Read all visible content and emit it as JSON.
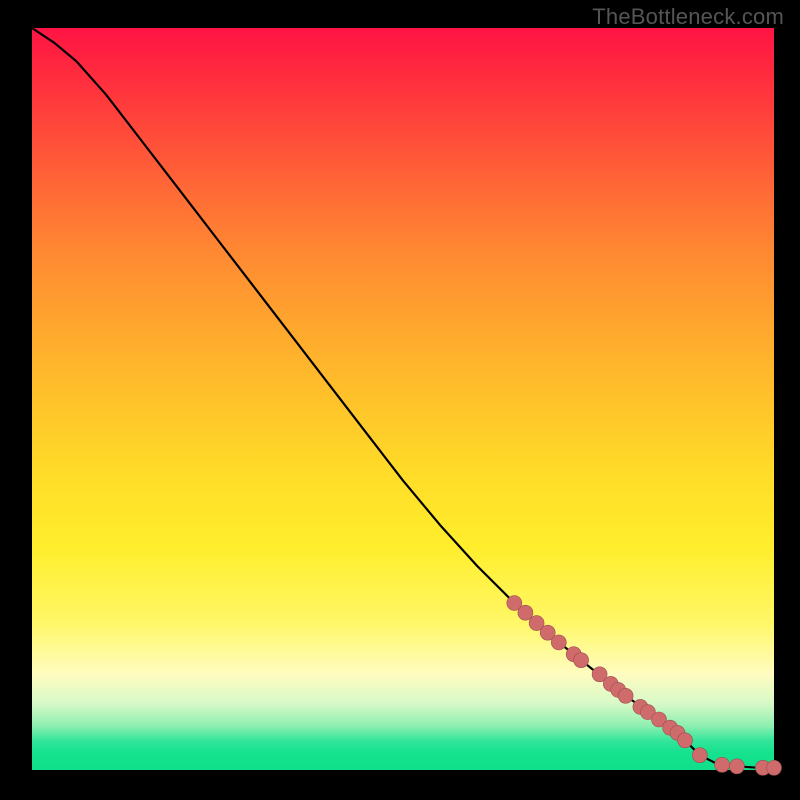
{
  "watermark": "TheBottleneck.com",
  "colors": {
    "dot_fill": "#cf6b6b",
    "dot_stroke": "#9c4f4f",
    "line": "#000000",
    "frame": "#000000"
  },
  "chart_data": {
    "type": "line",
    "title": "",
    "xlabel": "",
    "ylabel": "",
    "xlim": [
      0,
      100
    ],
    "ylim": [
      0,
      100
    ],
    "grid": false,
    "legend": false,
    "curve_note": "line starts near top-left, slight shoulder, then near-linear descent to x≈90 where it flattens to y≈0",
    "x": [
      0,
      3,
      6,
      10,
      15,
      20,
      25,
      30,
      35,
      40,
      45,
      50,
      55,
      60,
      65,
      70,
      75,
      80,
      85,
      88,
      90,
      92,
      95,
      98,
      100
    ],
    "y": [
      100,
      98,
      95.5,
      91,
      84.5,
      78,
      71.5,
      65,
      58.5,
      52,
      45.5,
      39,
      33,
      27.5,
      22.5,
      18,
      14,
      10,
      6.5,
      4,
      2,
      1,
      0.5,
      0.3,
      0.3
    ],
    "series": [
      {
        "name": "highlighted-points",
        "note": "salmon dots along lower portion of the curve and along the flat tail",
        "points": [
          {
            "x": 65,
            "y": 22.5
          },
          {
            "x": 66.5,
            "y": 21.2
          },
          {
            "x": 68,
            "y": 19.8
          },
          {
            "x": 69.5,
            "y": 18.5
          },
          {
            "x": 71,
            "y": 17.2
          },
          {
            "x": 73,
            "y": 15.6
          },
          {
            "x": 74,
            "y": 14.8
          },
          {
            "x": 76.5,
            "y": 12.9
          },
          {
            "x": 78,
            "y": 11.6
          },
          {
            "x": 79,
            "y": 10.8
          },
          {
            "x": 80,
            "y": 10
          },
          {
            "x": 82,
            "y": 8.5
          },
          {
            "x": 83,
            "y": 7.8
          },
          {
            "x": 84.5,
            "y": 6.8
          },
          {
            "x": 86,
            "y": 5.7
          },
          {
            "x": 87,
            "y": 5
          },
          {
            "x": 88,
            "y": 4
          },
          {
            "x": 90,
            "y": 2
          },
          {
            "x": 93,
            "y": 0.7
          },
          {
            "x": 95,
            "y": 0.5
          },
          {
            "x": 98.5,
            "y": 0.3
          },
          {
            "x": 100,
            "y": 0.3
          }
        ]
      }
    ]
  }
}
